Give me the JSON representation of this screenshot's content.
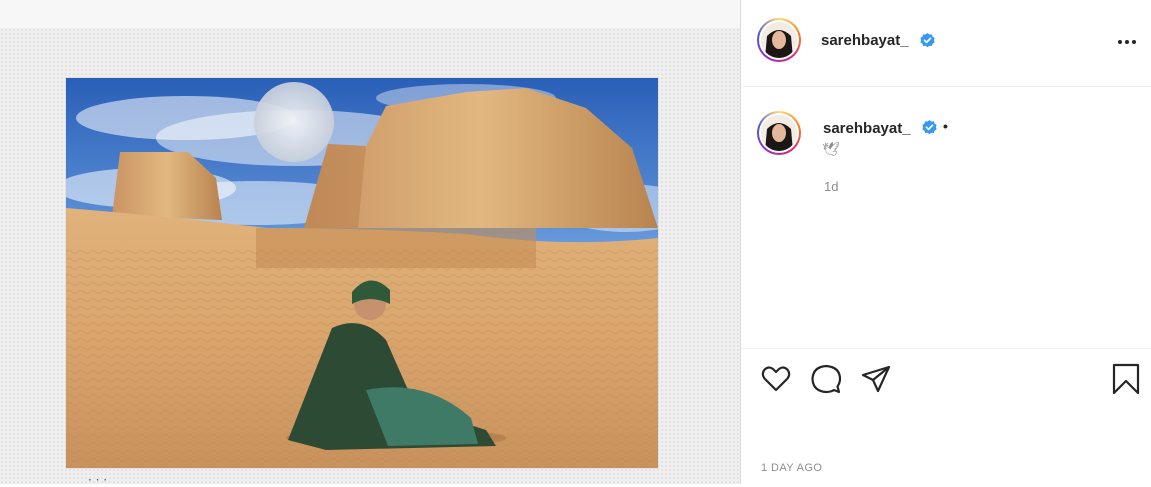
{
  "post": {
    "username": "sarehbayat_",
    "caption_glyph": "· · ·",
    "timestamp": "1 DAY AGO"
  },
  "comment": {
    "username": "sarehbayat_",
    "separator": "•",
    "text": "🕊",
    "time": "1d"
  },
  "icons": {
    "verified": "verified-badge-icon",
    "more": "more-options-icon",
    "like": "heart-icon",
    "comment": "comment-icon",
    "share": "paper-plane-icon",
    "save": "bookmark-icon"
  },
  "colors": {
    "verified_blue": "#3897f0",
    "text_primary": "#262626",
    "text_secondary": "#8e8e8e",
    "border": "#dbdbdb"
  }
}
